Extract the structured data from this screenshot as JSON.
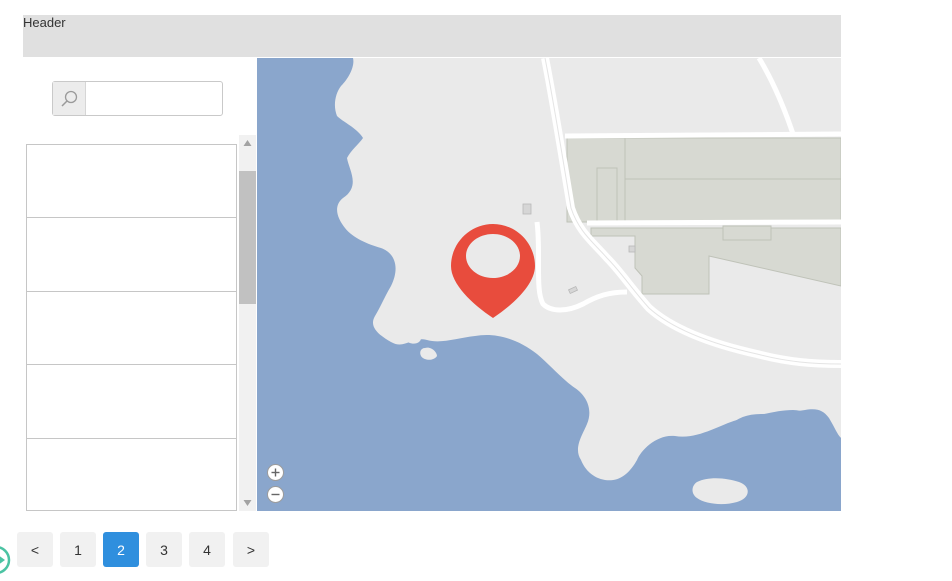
{
  "header": {
    "title": "Header"
  },
  "search": {
    "placeholder": "",
    "value": ""
  },
  "list": {
    "items": [
      "",
      "",
      "",
      "",
      ""
    ]
  },
  "map": {
    "pin_color": "#e84c3d",
    "water_color": "#8aa6cc",
    "land_color": "#eaeaea",
    "zoom_in_icon": "plus-icon",
    "zoom_out_icon": "minus-icon"
  },
  "pagination": {
    "prev_label": "<",
    "pages": [
      "1",
      "2",
      "3",
      "4"
    ],
    "active_page": "2",
    "next_label": ">",
    "active_color": "#2f8fde"
  }
}
